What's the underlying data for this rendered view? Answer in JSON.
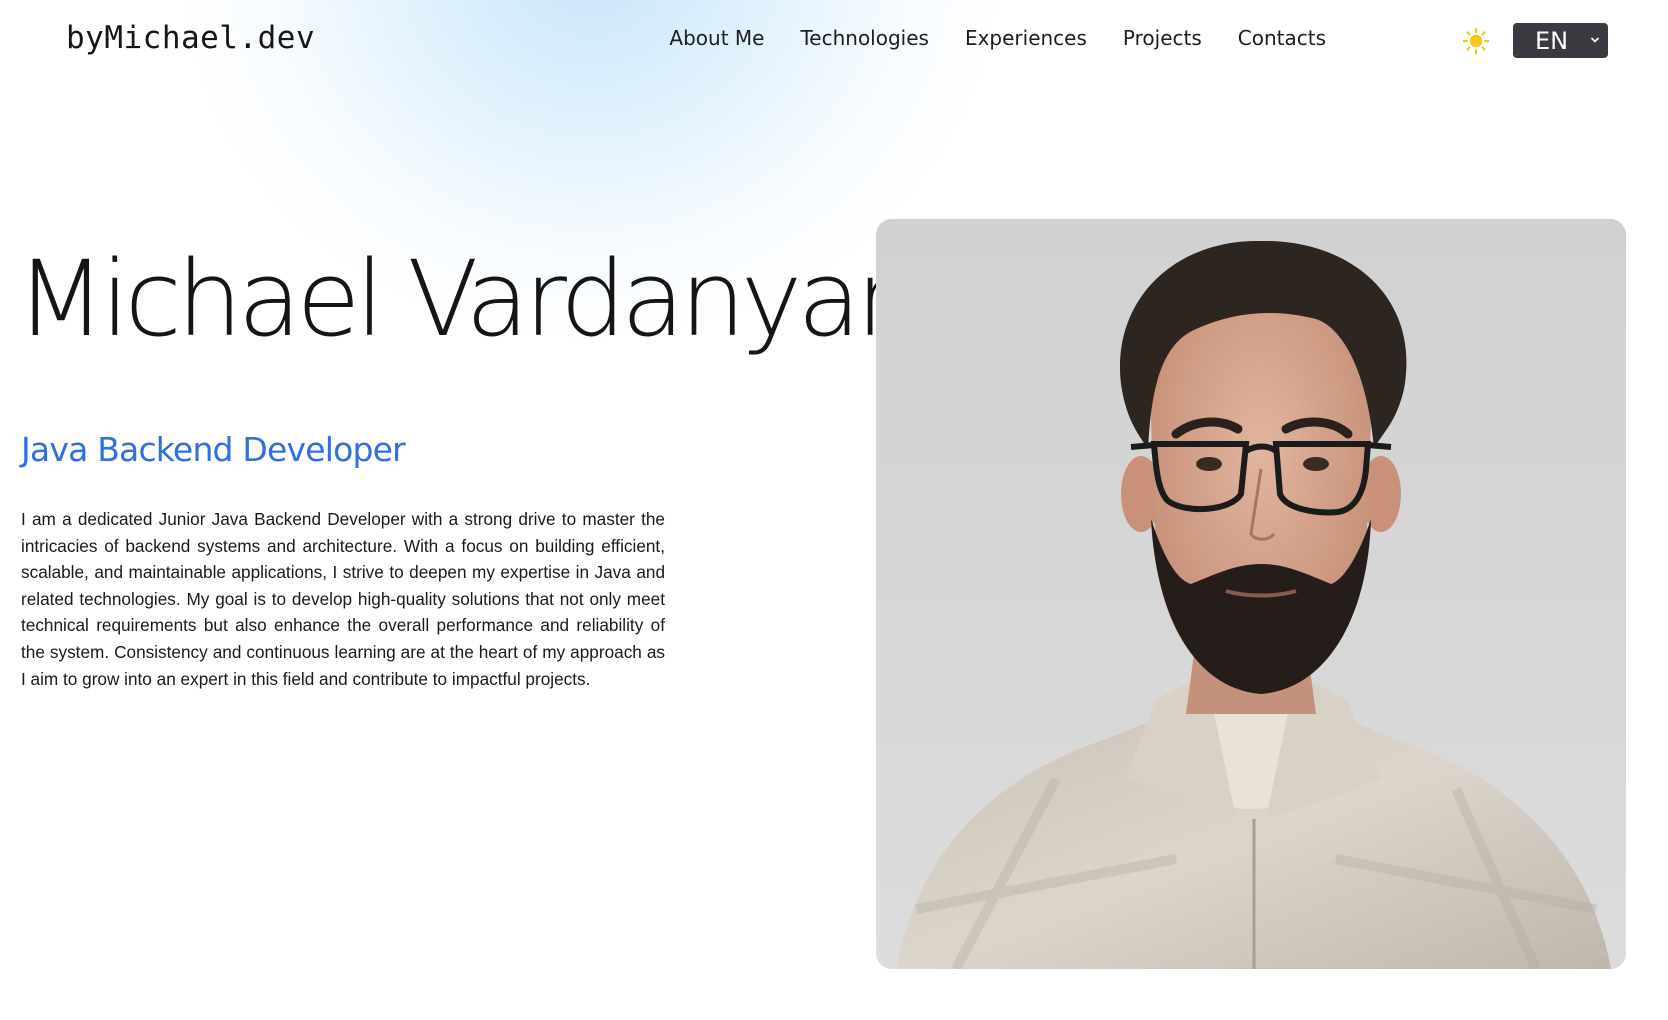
{
  "header": {
    "logo": "byMichael.dev",
    "nav": [
      {
        "label": "About Me"
      },
      {
        "label": "Technologies"
      },
      {
        "label": "Experiences"
      },
      {
        "label": "Projects"
      },
      {
        "label": "Contacts"
      }
    ],
    "theme_icon": "sun-icon",
    "language": {
      "selected": "EN"
    }
  },
  "hero": {
    "name": "Michael Vardanyan",
    "role": "Java Backend Developer",
    "bio": "I am a dedicated Junior Java Backend Developer with a strong drive to master the intricacies of backend systems and architecture. With a focus on building efficient, scalable, and maintainable applications, I strive to deepen my expertise in Java and related technologies. My goal is to develop high-quality solutions that not only meet technical requirements but also enhance the overall performance and reliability of the system. Consistency and continuous learning are at the heart of my approach as I aim to grow into an expert in this field and contribute to impactful projects."
  },
  "colors": {
    "accent": "#2f6fe0",
    "sun": "#f5c518",
    "select_bg": "#393b41"
  }
}
